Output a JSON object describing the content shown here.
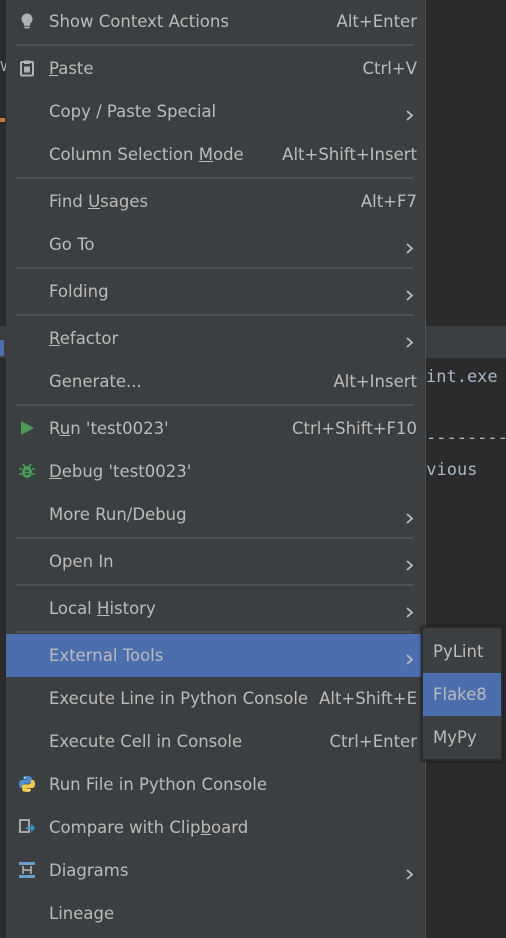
{
  "editor": {
    "line1": "int.exe",
    "line2": "--------",
    "line3": "evious",
    "left_mark": "V"
  },
  "menu": {
    "items": [
      {
        "label": "Show Context Actions",
        "shortcut": "Alt+Enter",
        "icon": "lightbulb-icon"
      },
      {
        "label": "Paste",
        "mnemonic": "P",
        "shortcut": "Ctrl+V",
        "icon": "clipboard-icon"
      },
      {
        "label": "Copy / Paste Special",
        "submenu": true
      },
      {
        "label": "Column Selection Mode",
        "mnemonic": "M",
        "shortcut": "Alt+Shift+Insert"
      },
      {
        "label": "Find Usages",
        "mnemonic": "U",
        "shortcut": "Alt+F7"
      },
      {
        "label": "Go To",
        "submenu": true
      },
      {
        "label": "Folding",
        "submenu": true
      },
      {
        "label": "Refactor",
        "mnemonic": "R",
        "submenu": true
      },
      {
        "label": "Generate...",
        "shortcut": "Alt+Insert"
      },
      {
        "label": "Run 'test0023'",
        "mnemonic": "u",
        "shortcut": "Ctrl+Shift+F10",
        "icon": "run-icon"
      },
      {
        "label": "Debug 'test0023'",
        "mnemonic": "D",
        "icon": "debug-bug-icon"
      },
      {
        "label": "More Run/Debug",
        "submenu": true
      },
      {
        "label": "Open In",
        "submenu": true
      },
      {
        "label": "Local History",
        "mnemonic": "H",
        "submenu": true
      },
      {
        "label": "External Tools",
        "submenu": true,
        "selected": true
      },
      {
        "label": "Execute Line in Python Console",
        "shortcut": "Alt+Shift+E"
      },
      {
        "label": "Execute Cell in Console",
        "shortcut": "Ctrl+Enter"
      },
      {
        "label": "Run File in Python Console",
        "icon": "python-icon"
      },
      {
        "label": "Compare with Clipboard",
        "mnemonic": "b",
        "icon": "compare-icon"
      },
      {
        "label": "Diagrams",
        "submenu": true,
        "icon": "diagram-icon"
      },
      {
        "label": "Lineage"
      }
    ]
  },
  "submenu": {
    "items": [
      {
        "label": "PyLint"
      },
      {
        "label": "Flake8",
        "selected": true
      },
      {
        "label": "MyPy"
      }
    ]
  },
  "colors": {
    "menu_bg": "#3c3f41",
    "selection": "#4b6eaf",
    "text": "#bbbbbb",
    "separator": "#515151",
    "run_green": "#499c54"
  }
}
